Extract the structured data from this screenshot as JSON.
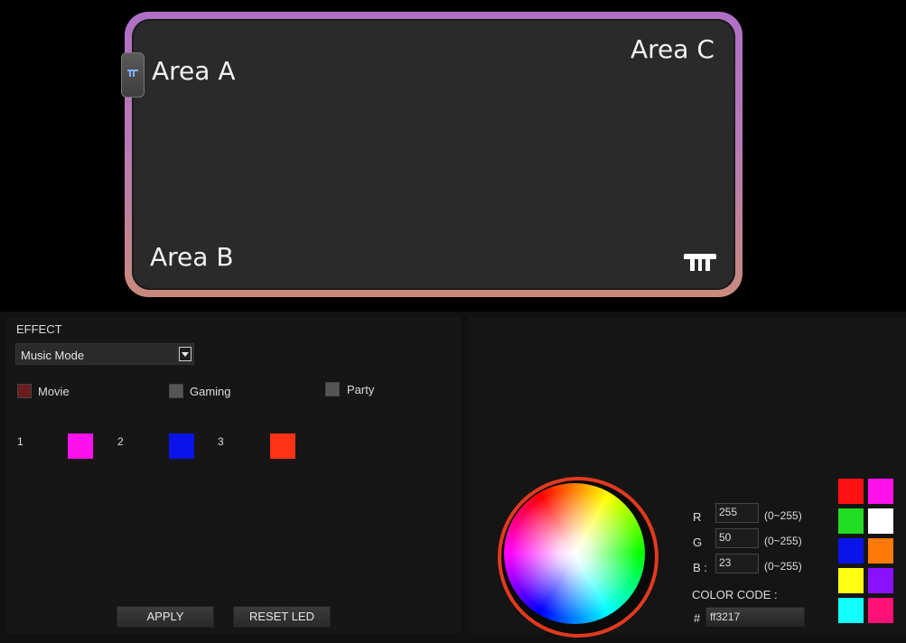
{
  "device": {
    "areas": {
      "a": "Area A",
      "b": "Area B",
      "c": "Area C"
    }
  },
  "effect": {
    "title": "EFFECT",
    "selected": "Music Mode",
    "modes": [
      {
        "label": "Movie",
        "checked": true,
        "color": "#6b1d1d"
      },
      {
        "label": "Gaming",
        "checked": false,
        "color": "#555555"
      },
      {
        "label": "Party",
        "checked": false,
        "color": "#555555"
      }
    ],
    "slots": [
      {
        "number": "1",
        "color": "#ff11ee"
      },
      {
        "number": "2",
        "color": "#0a14e8"
      },
      {
        "number": "3",
        "color": "#ff3217"
      }
    ]
  },
  "buttons": {
    "apply": "APPLY",
    "reset": "RESET LED"
  },
  "color": {
    "r_label": "R",
    "g_label": "G",
    "b_label": "B :",
    "r": "255",
    "g": "50",
    "b": "23",
    "range": "(0~255)",
    "code_label": "COLOR CODE :",
    "hash": "#",
    "code": "ff3217",
    "wheel_ring": "#e23a1f"
  },
  "presets": [
    "#ff1111",
    "#ff11ee",
    "#22dd22",
    "#ffffff",
    "#0a14e8",
    "#ff7a0a",
    "#ffff11",
    "#8a11ff",
    "#11ffff",
    "#ff1177"
  ]
}
